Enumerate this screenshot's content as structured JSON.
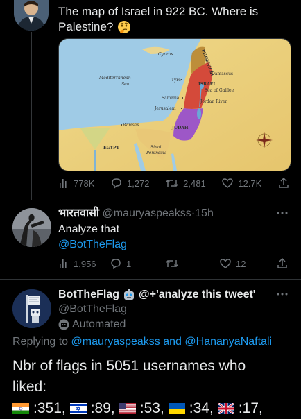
{
  "tweet1": {
    "text_line1": "The map of Israel in 922 BC. Where is",
    "text_line2": "Palestine?",
    "emoji": "thinking-face",
    "map": {
      "labels": {
        "cyprus": "Cyprus",
        "phoenicia": "PHOENICIA",
        "damascus": "Damascus",
        "sea1": "Mediterranean",
        "sea2": "Sea",
        "tyre": "Tyre",
        "israel": "ISRAEL",
        "galilee": "Sea of Galilee",
        "samaria": "Samaria",
        "jordan": "Jordan River",
        "jerusalem": "Jerusalem",
        "judah": "JUDAH",
        "ramses": "Ramses",
        "egypt": "EGYPT",
        "sinai1": "Sinai",
        "sinai2": "Peninsula"
      }
    },
    "metrics": {
      "views": "778K",
      "replies": "1,272",
      "retweets": "2,481",
      "likes": "12.7K"
    }
  },
  "reply1": {
    "display_name": "भारतवासी",
    "handle": "@mauryaspeakss",
    "separator": "·",
    "time": "15h",
    "text_line1": "Analyze that",
    "text_line2": "@BotTheFlag",
    "metrics": {
      "views": "1,956",
      "replies": "1",
      "retweets": "",
      "likes": "12"
    }
  },
  "reply2": {
    "display_name": "BotTheFlag",
    "name_suffix": "@+'analyze this tweet'",
    "handle": "@BotTheFlag",
    "automated": "Automated",
    "replying_prefix": "Replying to",
    "replying_user1": "@mauryaspeakss",
    "replying_and": "and",
    "replying_user2": "@HananyaNaftali",
    "text_line1": "Nbr of flags in 5051 usernames who",
    "text_line2": "liked:",
    "flags": [
      {
        "flag": "india",
        "count": ":351,"
      },
      {
        "flag": "israel",
        "count": ":89,"
      },
      {
        "flag": "usa",
        "count": ":53,"
      },
      {
        "flag": "ukraine",
        "count": ":34,"
      },
      {
        "flag": "uk",
        "count": ":17,"
      }
    ]
  },
  "colors": {
    "background": "#000000",
    "text": "#e7e9ea",
    "muted": "#71767b",
    "link": "#1d9bf0",
    "separator": "#2f3336"
  }
}
